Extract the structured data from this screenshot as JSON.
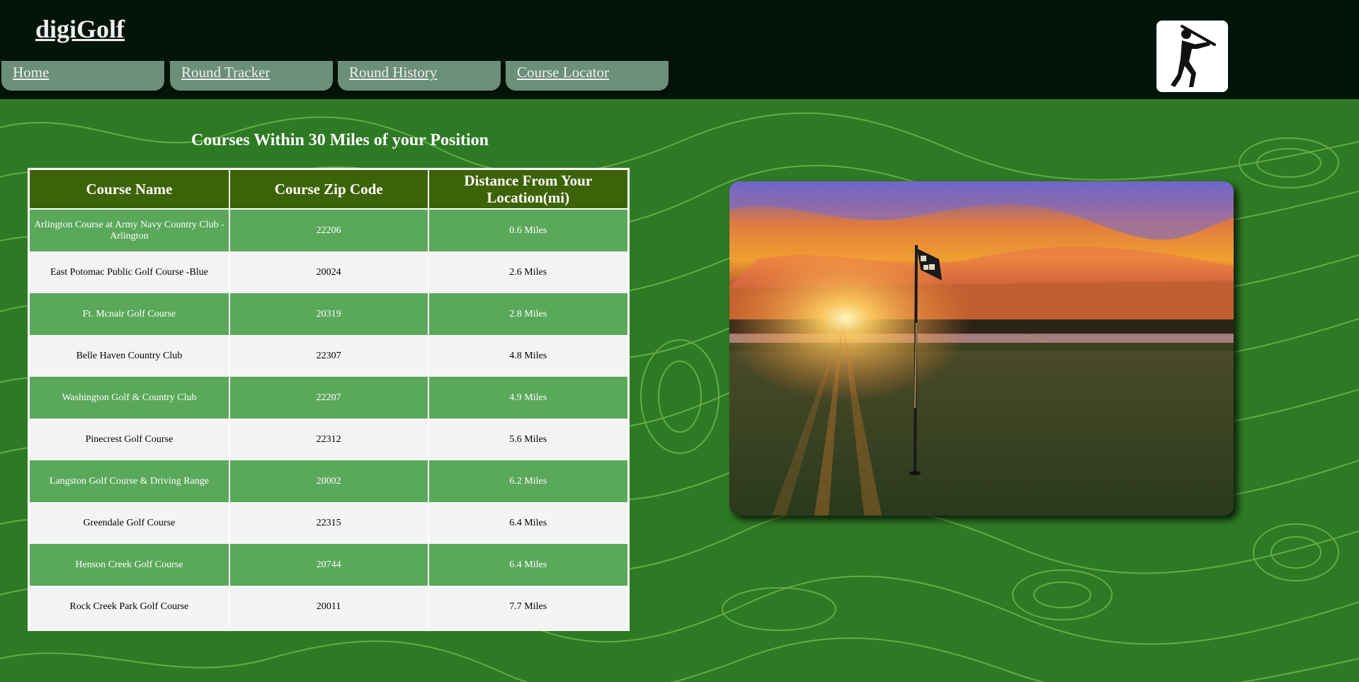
{
  "app": {
    "logo": "digiGolf"
  },
  "nav": {
    "items": [
      {
        "label": "Home"
      },
      {
        "label": "Round Tracker"
      },
      {
        "label": "Round History"
      },
      {
        "label": "Course Locator"
      }
    ]
  },
  "header_icon": "golfer-swing-icon",
  "main": {
    "title": "Courses Within 30 Miles of your Position",
    "table": {
      "headers": [
        "Course Name",
        "Course Zip Code",
        "Distance From Your Location(mi)"
      ],
      "rows": [
        {
          "name": "Arlington Course at Army Navy Country Club - Arlington",
          "zip": "22206",
          "distance": "0.6 Miles"
        },
        {
          "name": "East Potomac Public Golf Course -Blue",
          "zip": "20024",
          "distance": "2.6 Miles"
        },
        {
          "name": "Ft. Mcnair Golf Course",
          "zip": "20319",
          "distance": "2.8 Miles"
        },
        {
          "name": "Belle Haven Country Club",
          "zip": "22307",
          "distance": "4.8 Miles"
        },
        {
          "name": "Washington Golf & Country Club",
          "zip": "22207",
          "distance": "4.9 Miles"
        },
        {
          "name": "Pinecrest Golf Course",
          "zip": "22312",
          "distance": "5.6 Miles"
        },
        {
          "name": "Langston Golf Course & Driving Range",
          "zip": "20002",
          "distance": "6.2 Miles"
        },
        {
          "name": "Greendale Golf Course",
          "zip": "22315",
          "distance": "6.4 Miles"
        },
        {
          "name": "Henson Creek Golf Course",
          "zip": "20744",
          "distance": "6.4 Miles"
        },
        {
          "name": "Rock Creek Park Golf Course",
          "zip": "20011",
          "distance": "7.7 Miles"
        }
      ]
    }
  },
  "colors": {
    "header_bg": "#03150a",
    "nav_tab": "#6b8f78",
    "page_bg": "#2e7a24",
    "topo_line": "#8fd462",
    "table_header": "#3d6307",
    "row_green": "#5aa85a",
    "row_light": "#f4f4f4"
  }
}
